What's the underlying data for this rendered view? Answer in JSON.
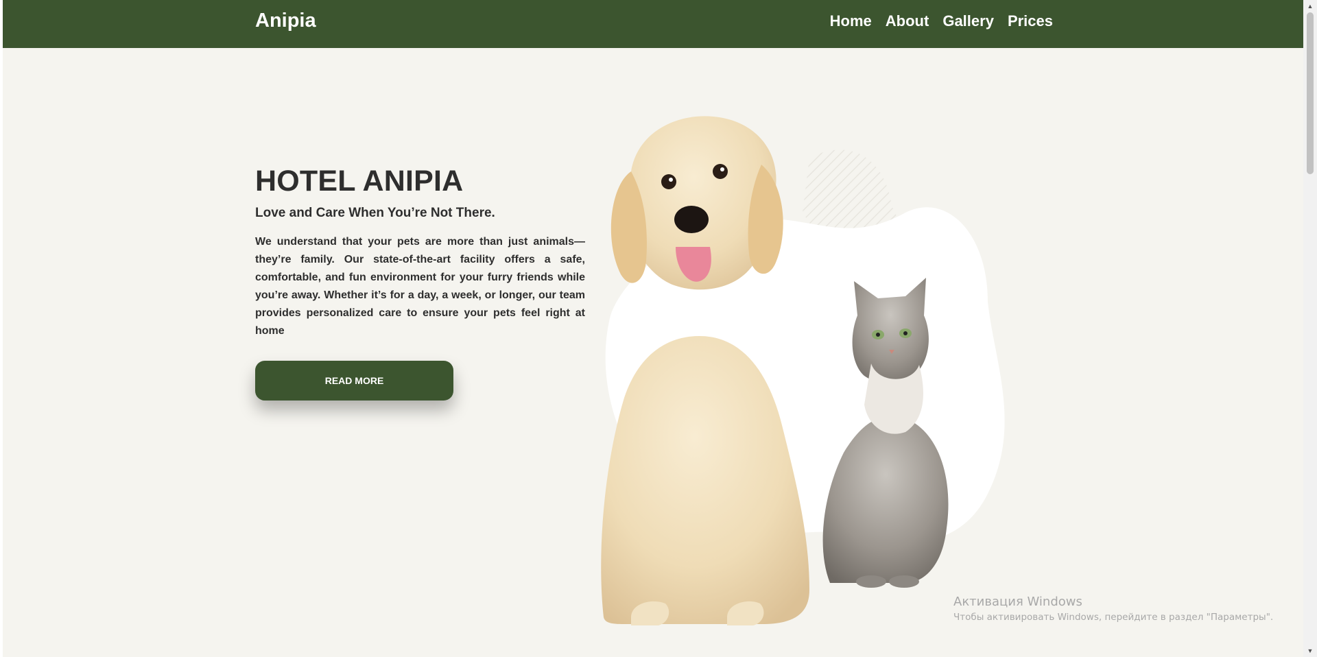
{
  "nav": {
    "brand": "Anipia",
    "items": [
      {
        "label": "Home"
      },
      {
        "label": "About"
      },
      {
        "label": "Gallery"
      },
      {
        "label": "Prices"
      }
    ]
  },
  "hero": {
    "title": "HOTEL ANIPIA",
    "subtitle": "Love and Care When You’re Not There.",
    "description": "We understand that your pets are more than just animals—they’re family. Our state-of-the-art facility offers a safe, comfortable, and fun environment for your furry friends while you’re away. Whether it’s for a day, a week, or longer, our team provides personalized care to ensure your pets feel right at home",
    "button_label": "READ MORE"
  },
  "watermark": {
    "title": "Активация Windows",
    "body": "Чтобы активировать Windows, перейдите в раздел \"Параметры\"."
  },
  "colors": {
    "brand_green": "#3c552f",
    "page_background": "#f5f4ef",
    "text_dark": "#2e2e2e"
  },
  "icons": {
    "hero_image": "dog-and-cat-photo",
    "scroll_up": "scroll-up-arrow-icon",
    "scroll_down": "scroll-down-arrow-icon"
  }
}
